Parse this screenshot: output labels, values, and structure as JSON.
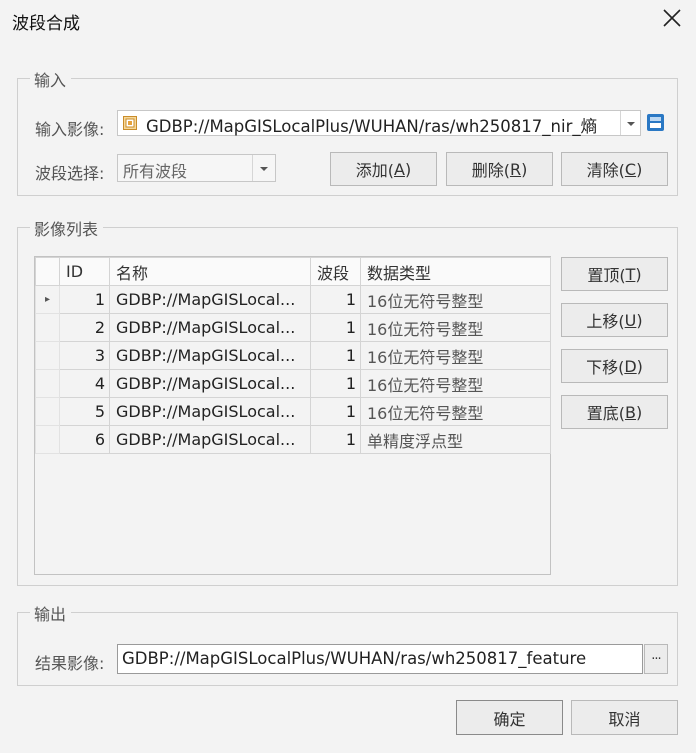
{
  "window": {
    "title": "波段合成"
  },
  "input_group": {
    "legend": "输入",
    "image_label": "输入影像:",
    "image_value": "GDBP://MapGISLocalPlus/WUHAN/ras/wh250817_nir_熵",
    "band_label": "波段选择:",
    "band_value": "所有波段",
    "add_label": "添加(",
    "add_key": "A",
    "delete_label": "删除(",
    "delete_key": "R",
    "clear_label": "清除(",
    "clear_key": "C"
  },
  "image_list": {
    "legend": "影像列表",
    "columns": [
      "ID",
      "名称",
      "波段",
      "数据类型"
    ],
    "rows": [
      {
        "id": "1",
        "name": "GDBP://MapGISLocal...",
        "band": "1",
        "dtype": "16位无符号整型"
      },
      {
        "id": "2",
        "name": "GDBP://MapGISLocal...",
        "band": "1",
        "dtype": "16位无符号整型"
      },
      {
        "id": "3",
        "name": "GDBP://MapGISLocal...",
        "band": "1",
        "dtype": "16位无符号整型"
      },
      {
        "id": "4",
        "name": "GDBP://MapGISLocal...",
        "band": "1",
        "dtype": "16位无符号整型"
      },
      {
        "id": "5",
        "name": "GDBP://MapGISLocal...",
        "band": "1",
        "dtype": "16位无符号整型"
      },
      {
        "id": "6",
        "name": "GDBP://MapGISLocal...",
        "band": "1",
        "dtype": "单精度浮点型"
      }
    ],
    "top_label": "置顶(",
    "top_key": "T",
    "up_label": "上移(",
    "up_key": "U",
    "down_label": "下移(",
    "down_key": "D",
    "bottom_label": "置底(",
    "bottom_key": "B"
  },
  "output_group": {
    "legend": "输出",
    "result_label": "结果影像:",
    "result_value": "GDBP://MapGISLocalPlus/WUHAN/ras/wh250817_feature",
    "browse_label": "···"
  },
  "footer": {
    "ok_label": "确定",
    "cancel_label": "取消"
  },
  "icons": {
    "close": "close-icon",
    "image": "raster-image-icon",
    "db": "database-icon"
  },
  "colors": {
    "accent": "#2a78c4",
    "background": "#f3f3f3"
  }
}
